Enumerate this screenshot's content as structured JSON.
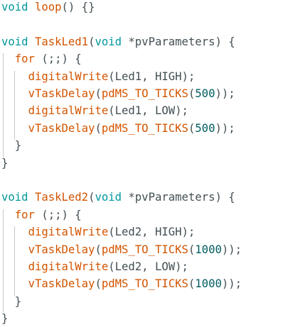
{
  "colors": {
    "keyword": "#00979c",
    "function": "#d35400",
    "number": "#005c5f",
    "text": "#434f54",
    "indent_guide": "#c8c8c8",
    "background": "#ffffff"
  },
  "code": [
    [
      {
        "t": "kw",
        "v": "void"
      },
      {
        "t": "plain",
        "v": " "
      },
      {
        "t": "fn",
        "v": "loop"
      },
      {
        "t": "plain",
        "v": "() {}"
      }
    ],
    [],
    [
      {
        "t": "kw",
        "v": "void"
      },
      {
        "t": "plain",
        "v": " "
      },
      {
        "t": "fn",
        "v": "TaskLed1"
      },
      {
        "t": "plain",
        "v": "("
      },
      {
        "t": "kw",
        "v": "void"
      },
      {
        "t": "plain",
        "v": " *pvParameters) {"
      }
    ],
    [
      {
        "t": "plain",
        "v": "  "
      },
      {
        "t": "fn",
        "v": "for"
      },
      {
        "t": "plain",
        "v": " (;;) {"
      }
    ],
    [
      {
        "t": "plain",
        "v": "    "
      },
      {
        "t": "fn",
        "v": "digitalWrite"
      },
      {
        "t": "plain",
        "v": "(Led1, HIGH);"
      }
    ],
    [
      {
        "t": "plain",
        "v": "    "
      },
      {
        "t": "fn",
        "v": "vTaskDelay"
      },
      {
        "t": "plain",
        "v": "("
      },
      {
        "t": "fn",
        "v": "pdMS_TO_TICKS"
      },
      {
        "t": "plain",
        "v": "("
      },
      {
        "t": "num",
        "v": "500"
      },
      {
        "t": "plain",
        "v": "));"
      }
    ],
    [
      {
        "t": "plain",
        "v": "    "
      },
      {
        "t": "fn",
        "v": "digitalWrite"
      },
      {
        "t": "plain",
        "v": "(Led1, LOW);"
      }
    ],
    [
      {
        "t": "plain",
        "v": "    "
      },
      {
        "t": "fn",
        "v": "vTaskDelay"
      },
      {
        "t": "plain",
        "v": "("
      },
      {
        "t": "fn",
        "v": "pdMS_TO_TICKS"
      },
      {
        "t": "plain",
        "v": "("
      },
      {
        "t": "num",
        "v": "500"
      },
      {
        "t": "plain",
        "v": "));"
      }
    ],
    [
      {
        "t": "plain",
        "v": "  }"
      }
    ],
    [
      {
        "t": "plain",
        "v": "}"
      }
    ],
    [],
    [
      {
        "t": "kw",
        "v": "void"
      },
      {
        "t": "plain",
        "v": " "
      },
      {
        "t": "fn",
        "v": "TaskLed2"
      },
      {
        "t": "plain",
        "v": "("
      },
      {
        "t": "kw",
        "v": "void"
      },
      {
        "t": "plain",
        "v": " *pvParameters) {"
      }
    ],
    [
      {
        "t": "plain",
        "v": "  "
      },
      {
        "t": "fn",
        "v": "for"
      },
      {
        "t": "plain",
        "v": " (;;) {"
      }
    ],
    [
      {
        "t": "plain",
        "v": "    "
      },
      {
        "t": "fn",
        "v": "digitalWrite"
      },
      {
        "t": "plain",
        "v": "(Led2, HIGH);"
      }
    ],
    [
      {
        "t": "plain",
        "v": "    "
      },
      {
        "t": "fn",
        "v": "vTaskDelay"
      },
      {
        "t": "plain",
        "v": "("
      },
      {
        "t": "fn",
        "v": "pdMS_TO_TICKS"
      },
      {
        "t": "plain",
        "v": "("
      },
      {
        "t": "num",
        "v": "1000"
      },
      {
        "t": "plain",
        "v": "));"
      }
    ],
    [
      {
        "t": "plain",
        "v": "    "
      },
      {
        "t": "fn",
        "v": "digitalWrite"
      },
      {
        "t": "plain",
        "v": "(Led2, LOW);"
      }
    ],
    [
      {
        "t": "plain",
        "v": "    "
      },
      {
        "t": "fn",
        "v": "vTaskDelay"
      },
      {
        "t": "plain",
        "v": "("
      },
      {
        "t": "fn",
        "v": "pdMS_TO_TICKS"
      },
      {
        "t": "plain",
        "v": "("
      },
      {
        "t": "num",
        "v": "1000"
      },
      {
        "t": "plain",
        "v": "));"
      }
    ],
    [
      {
        "t": "plain",
        "v": "  }"
      }
    ],
    [
      {
        "t": "plain",
        "v": "}"
      }
    ]
  ]
}
